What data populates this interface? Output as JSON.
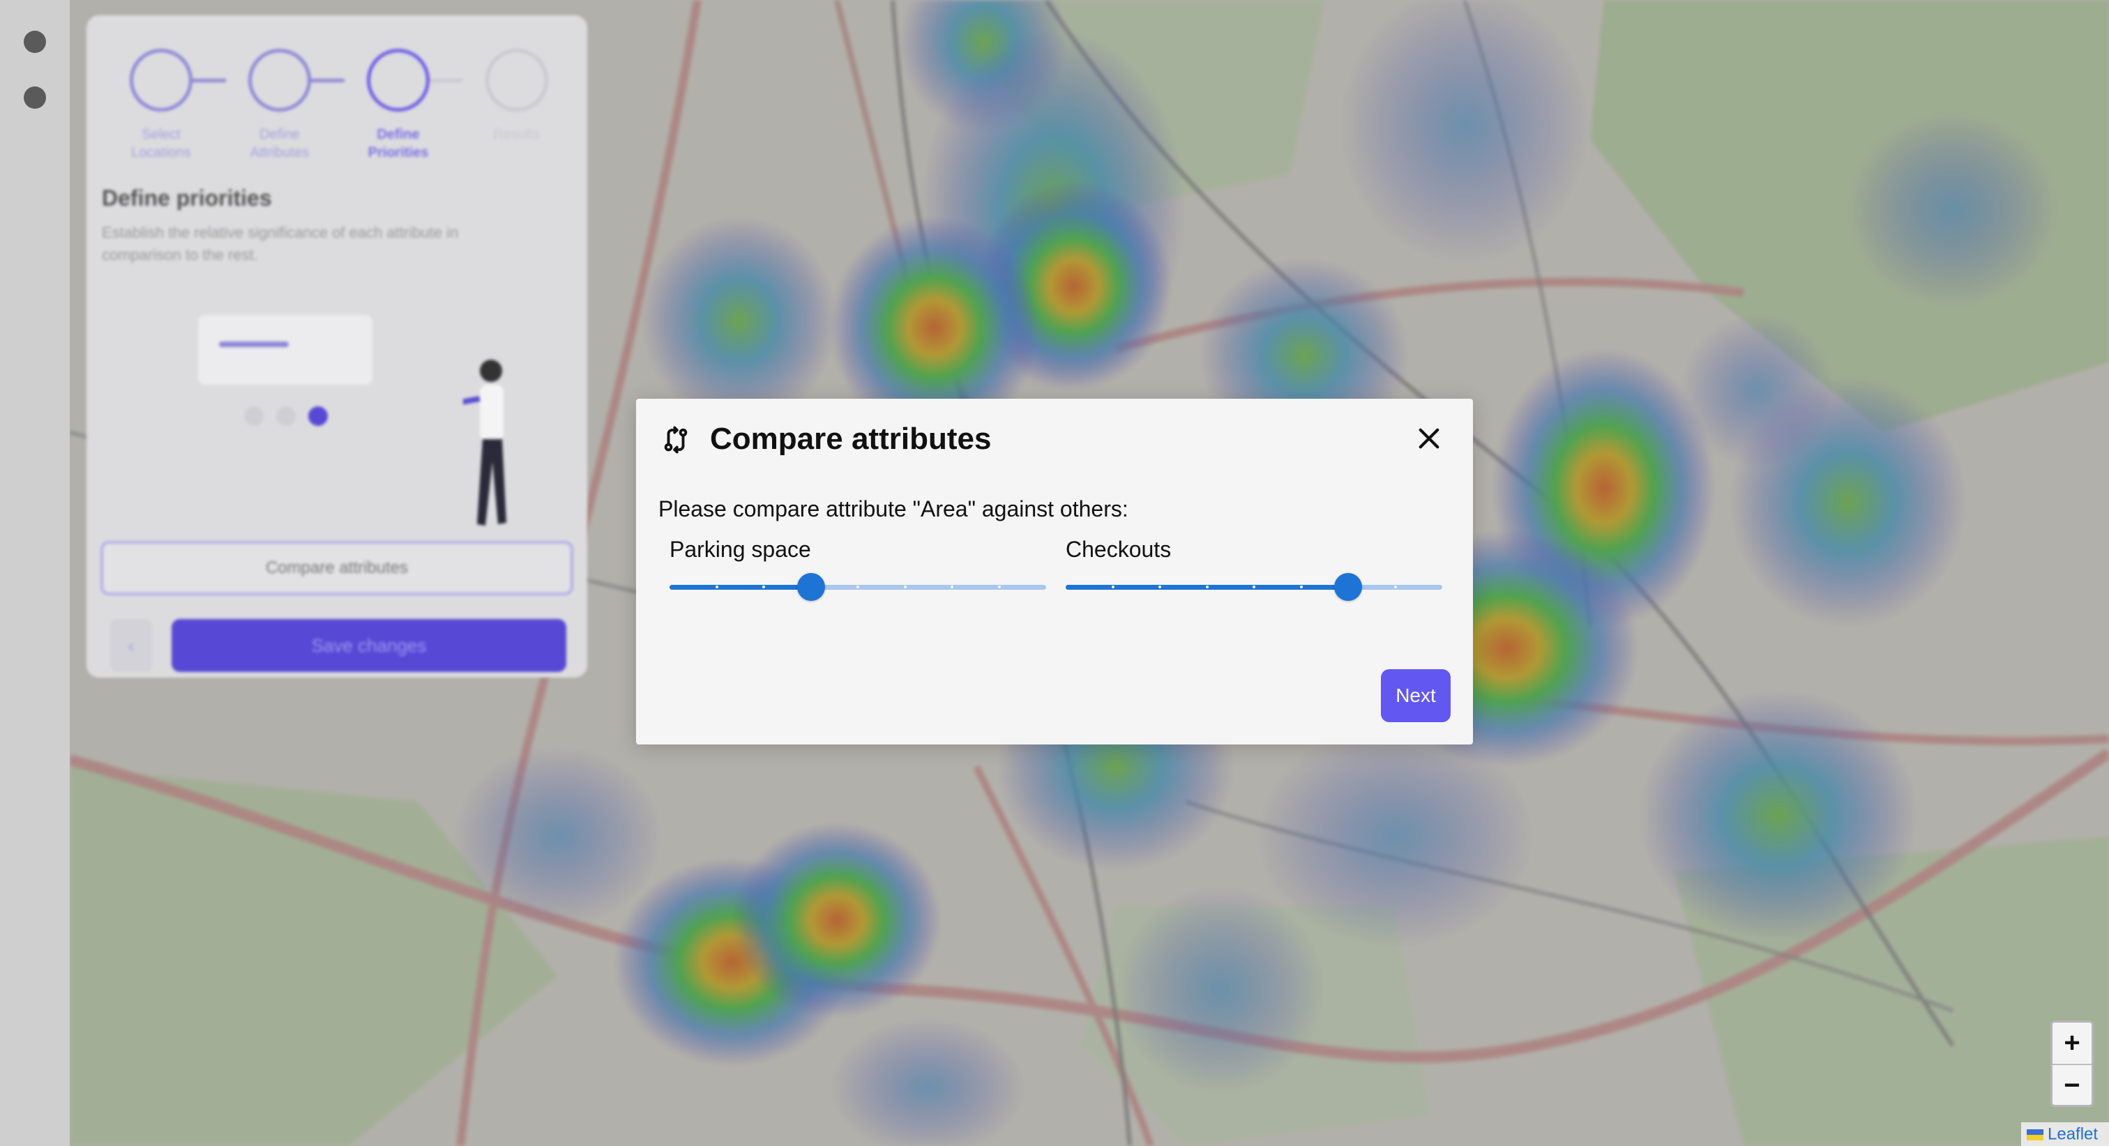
{
  "rail": {
    "icons": [
      "location-icon",
      "user-icon"
    ]
  },
  "map": {
    "zoom_in": "+",
    "zoom_out": "−",
    "attribution": "Leaflet"
  },
  "panel": {
    "steps": [
      {
        "label": "Select Locations"
      },
      {
        "label": "Define Attributes"
      },
      {
        "label": "Define Priorities"
      },
      {
        "label": "Results"
      }
    ],
    "title": "Define priorities",
    "description": "Establish the relative significance of each attribute in comparison to the rest.",
    "compare_button": "Compare attributes",
    "back_button": "‹",
    "save_button": "Save changes"
  },
  "modal": {
    "title": "Compare attributes",
    "prompt": "Please compare attribute \"Area\" against others:",
    "sliders": [
      {
        "label": "Parking space",
        "value": 3,
        "max": 8
      },
      {
        "label": "Checkouts",
        "value": 6,
        "max": 8
      }
    ],
    "next_button": "Next"
  },
  "colors": {
    "accent": "#6257f0",
    "slider": "#1e74d4",
    "slider_track": "#a9c6ec"
  }
}
